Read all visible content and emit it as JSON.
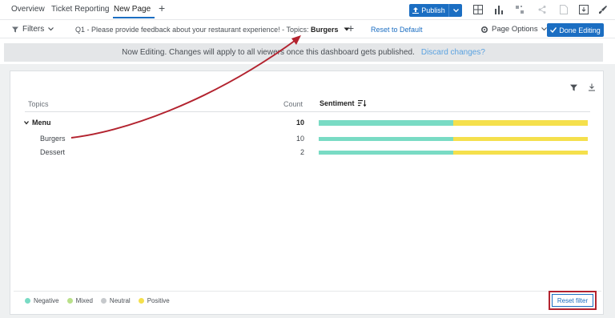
{
  "tabs": [
    {
      "label": "Overview"
    },
    {
      "label": "Ticket Reporting"
    },
    {
      "label": "New Page"
    }
  ],
  "toolbar": {
    "add_tab": "+",
    "publish_label": "Publish"
  },
  "filterbar": {
    "filters_label": "Filters",
    "filter_prefix": "Q1 - Please provide feedback about your restaurant experience! - Topics:",
    "filter_value": "Burgers",
    "add_filter": "+",
    "reset_default": "Reset to Default",
    "page_options": "Page Options",
    "done_editing": "Done Editing"
  },
  "banner": {
    "text": "Now Editing. Changes will apply to all viewers once this dashboard gets published.",
    "discard": "Discard changes?"
  },
  "widget": {
    "columns": {
      "topics": "Topics",
      "count": "Count",
      "sentiment": "Sentiment"
    },
    "rows": [
      {
        "label": "Menu",
        "count": "10",
        "negative": 0.5,
        "positive": 0.5
      },
      {
        "label": "Burgers",
        "count": "10",
        "negative": 0.5,
        "positive": 0.5
      },
      {
        "label": "Dessert",
        "count": "2",
        "negative": 0.5,
        "positive": 0.5
      }
    ],
    "legend": [
      {
        "label": "Negative",
        "color": "#79dbc4"
      },
      {
        "label": "Mixed",
        "color": "#b9e08a"
      },
      {
        "label": "Neutral",
        "color": "#c6c9cc"
      },
      {
        "label": "Positive",
        "color": "#f5e04c"
      }
    ],
    "reset_filter": "Reset filter"
  },
  "colors": {
    "accent": "#1b6ec2",
    "annotation": "#b3232f"
  }
}
